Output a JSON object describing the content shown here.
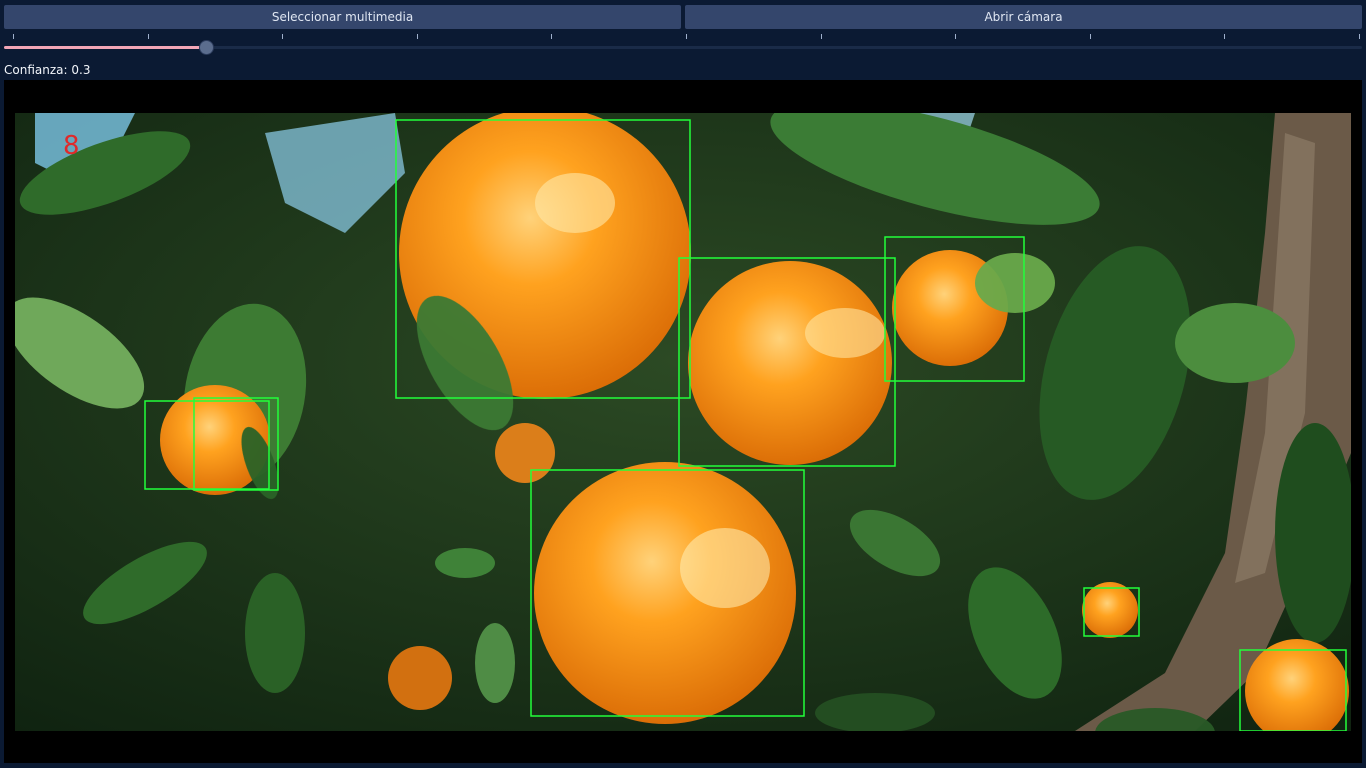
{
  "toolbar": {
    "select_media_label": "Seleccionar multimedia",
    "open_camera_label": "Abrir cámara"
  },
  "confidence": {
    "label": "Confianza:",
    "value": 0.3,
    "value_text": "0.3",
    "min": 0,
    "max": 1,
    "tick_count": 11
  },
  "detection": {
    "count_text": "8",
    "count_color": "#e02a2a",
    "box_color": "#22ff3a"
  },
  "colors": {
    "background": "#0b1a33",
    "button": "#34466c",
    "slider_fill": "#f2a6b7",
    "slider_thumb": "#5b6d8e"
  }
}
